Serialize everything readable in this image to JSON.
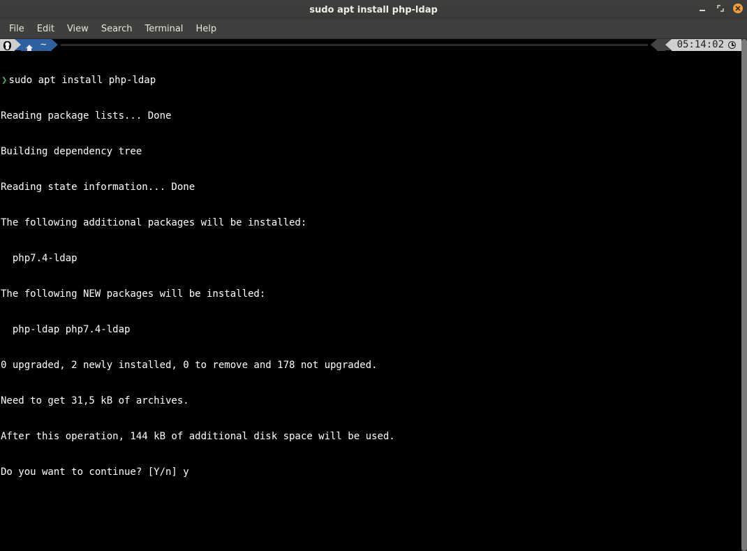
{
  "window": {
    "title": "sudo apt install php-ldap"
  },
  "menubar": {
    "items": [
      "File",
      "Edit",
      "View",
      "Search",
      "Terminal",
      "Help"
    ]
  },
  "status": {
    "path": "~",
    "clock": "05:14:02"
  },
  "prompt": {
    "glyph": "❯",
    "command": "sudo apt install php-ldap"
  },
  "output": [
    "Reading package lists... Done",
    "Building dependency tree",
    "Reading state information... Done",
    "The following additional packages will be installed:",
    "  php7.4-ldap",
    "The following NEW packages will be installed:",
    "  php-ldap php7.4-ldap",
    "0 upgraded, 2 newly installed, 0 to remove and 178 not upgraded.",
    "Need to get 31,5 kB of archives.",
    "After this operation, 144 kB of additional disk space will be used.",
    "Do you want to continue? [Y/n] y"
  ]
}
